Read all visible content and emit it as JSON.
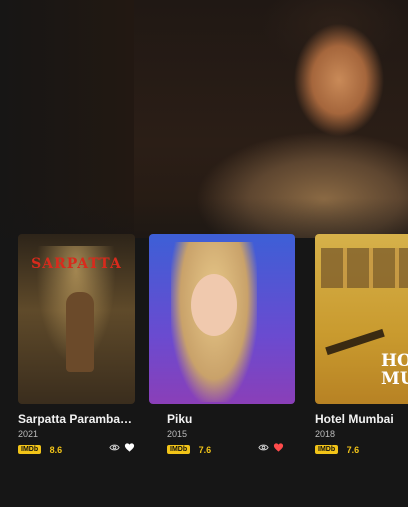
{
  "movies": [
    {
      "title": "Sarpatta Paramba…",
      "year": "2021",
      "imdb_label": "IMDb",
      "rating": "8.6",
      "poster_text": "SARPATTA",
      "favorite": false
    },
    {
      "title": "Piku",
      "year": "2015",
      "imdb_label": "IMDb",
      "rating": "7.6",
      "favorite": true
    },
    {
      "title": "Hotel Mumbai",
      "year": "2018",
      "imdb_label": "IMDb",
      "rating": "7.6",
      "poster_text": "HOT MUMB",
      "favorite": false
    }
  ],
  "colors": {
    "background": "#161616",
    "imdb_badge": "#f2c418",
    "favorite": "#ff4b4b",
    "icon": "#d8d8d8"
  }
}
